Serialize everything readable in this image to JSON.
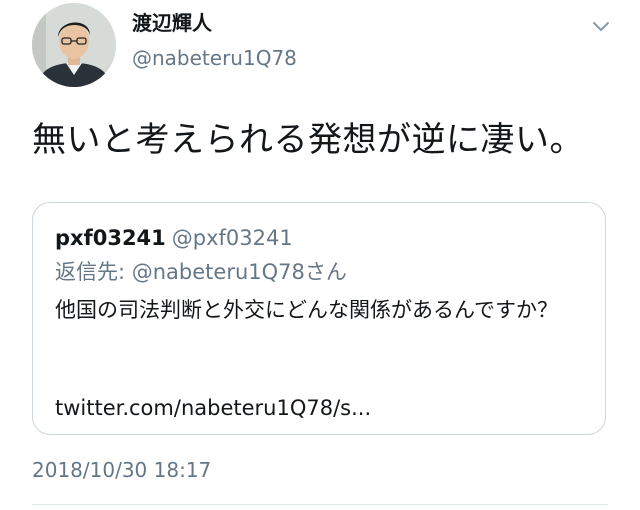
{
  "author": {
    "display_name": "渡辺輝人",
    "handle": "@nabeteru1Q78"
  },
  "menu_icon": "chevron-down-icon",
  "tweet": {
    "text": "無いと考えられる発想が逆に凄い。",
    "timestamp": "2018/10/30 18:17"
  },
  "quoted_tweet": {
    "display_name": "pxf03241",
    "handle": "@pxf03241",
    "reply_to": "返信先: @nabeteru1Q78さん",
    "body": "他国の司法判断と外交にどんな関係があるんですか？",
    "link": "twitter.com/nabeteru1Q78/s..."
  },
  "colors": {
    "secondary_text": "#657786",
    "border": "#ccd6dd",
    "primary_text": "#14171a"
  }
}
